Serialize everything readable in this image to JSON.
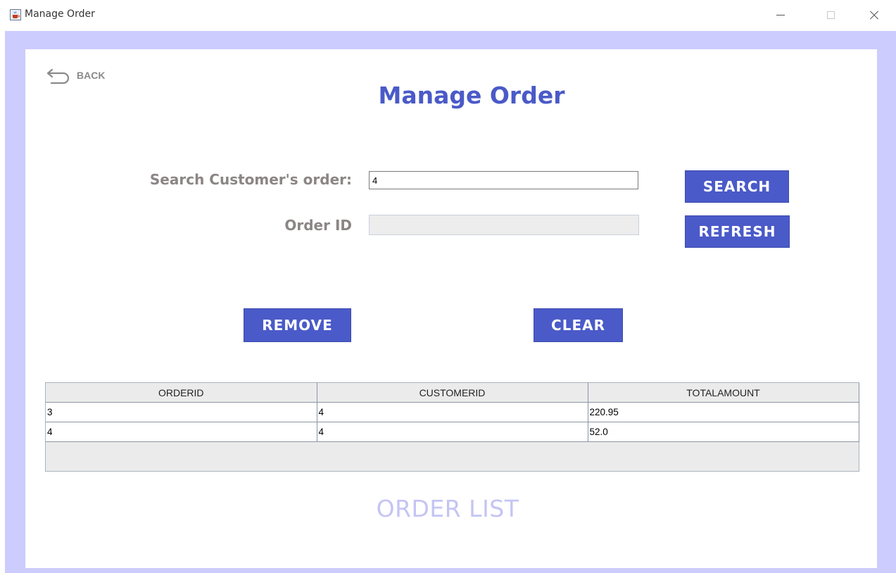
{
  "window": {
    "title": "Manage Order",
    "icon": "java-cup-icon"
  },
  "back": {
    "label": "BACK",
    "icon": "back-arrow-icon"
  },
  "page_title": "Manage Order",
  "form": {
    "search_label": "Search Customer's order:",
    "search_value": "4",
    "order_id_label": "Order ID",
    "order_id_value": ""
  },
  "buttons": {
    "search": "SEARCH",
    "refresh": "REFRESH",
    "remove": "REMOVE",
    "clear": "CLEAR"
  },
  "table": {
    "columns": [
      "ORDERID",
      "CUSTOMERID",
      "TOTALAMOUNT"
    ],
    "rows": [
      [
        "3",
        "4",
        "220.95"
      ],
      [
        "4",
        "4",
        "52.0"
      ]
    ]
  },
  "footer": "ORDER LIST",
  "colors": {
    "accent": "#4a5ac8",
    "frame": "#ccccfe",
    "label": "#8c8585",
    "footer": "#c4c4f4"
  }
}
